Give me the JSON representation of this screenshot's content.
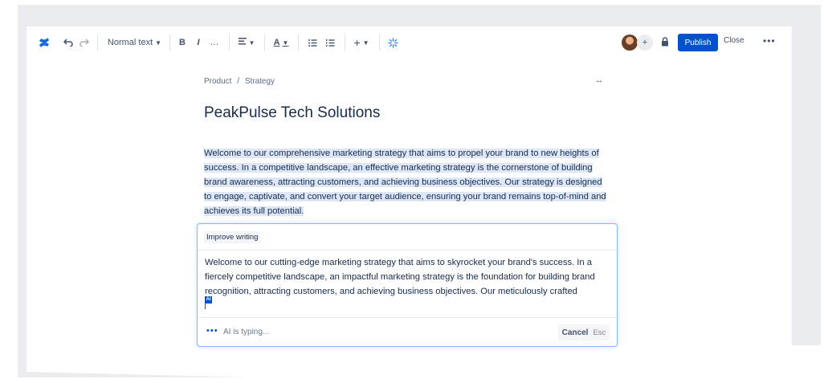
{
  "colors": {
    "accent": "#0052cc",
    "highlight": "#dde7f7",
    "ai_border": "#85b8ff"
  },
  "toolbar": {
    "logo_icon": "confluence-logo-icon",
    "undo_icon": "undo-icon",
    "redo_icon": "redo-icon",
    "text_style": "Normal text",
    "bold": "B",
    "italic": "I",
    "more_formatting": "…",
    "align_icon": "align-icon",
    "text_color": "A",
    "bullet_list_icon": "bullet-list-icon",
    "numbered_list_icon": "numbered-list-icon",
    "insert": "+",
    "ai_icon": "ai-sparkle-icon",
    "avatar_add": "+",
    "lock_icon": "lock-icon",
    "publish": "Publish",
    "close": "Close",
    "more": "•••"
  },
  "breadcrumb": {
    "parent": "Product",
    "separator": "/",
    "current": "Strategy"
  },
  "expand": "↔",
  "page": {
    "title": "PeakPulse Tech Solutions",
    "paragraph_lines": [
      "Welcome to our comprehensive marketing strategy that aims to propel your brand to new heights of",
      "success. In a competitive landscape, an effective marketing strategy is the cornerstone of building",
      "brand awareness, attracting customers, and achieving business objectives. Our strategy is designed",
      "to engage, captivate, and convert your target audience, ensuring your brand remains top-of-mind and",
      "achieves its full potential."
    ]
  },
  "ai_panel": {
    "action": "Improve writing",
    "text_lines": [
      "Welcome to our cutting-edge marketing strategy that aims to skyrocket your brand's success. In a",
      "fiercely competitive landscape, an impactful marketing strategy is the foundation for building brand",
      "recognition, attracting customers, and achieving business objectives. Our meticulously crafted"
    ],
    "cursor_label": "AI",
    "dots": "•••",
    "status": "AI is typing...",
    "cancel": "Cancel",
    "cancel_shortcut": "Esc"
  }
}
